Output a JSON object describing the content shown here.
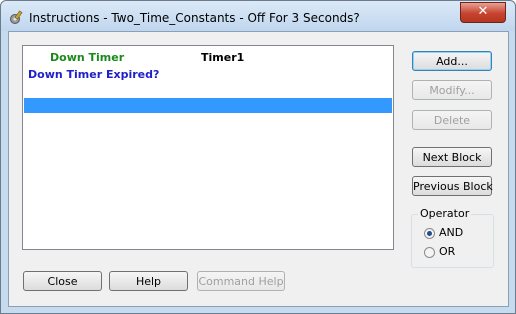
{
  "window": {
    "title": "Instructions - Two_Time_Constants - Off For 3 Seconds?",
    "close_glyph": "✕",
    "app_icon": "gear-wrench-icon"
  },
  "list": {
    "columns": [
      {
        "label": "Down Timer",
        "color": "#1b8a1b"
      },
      {
        "label": "Timer1",
        "color": "#000000"
      }
    ],
    "line": "Down Timer Expired?",
    "selected_row_color": "#3399ff"
  },
  "side_buttons": {
    "add": "Add...",
    "modify": "Modify...",
    "delete": "Delete",
    "next_block": "Next Block",
    "previous_block": "Previous Block"
  },
  "operator": {
    "label": "Operator",
    "options": [
      {
        "label": "AND",
        "selected": true
      },
      {
        "label": "OR",
        "selected": false
      }
    ]
  },
  "bottom_buttons": {
    "close": "Close",
    "help": "Help",
    "command_help": "Command Help"
  }
}
